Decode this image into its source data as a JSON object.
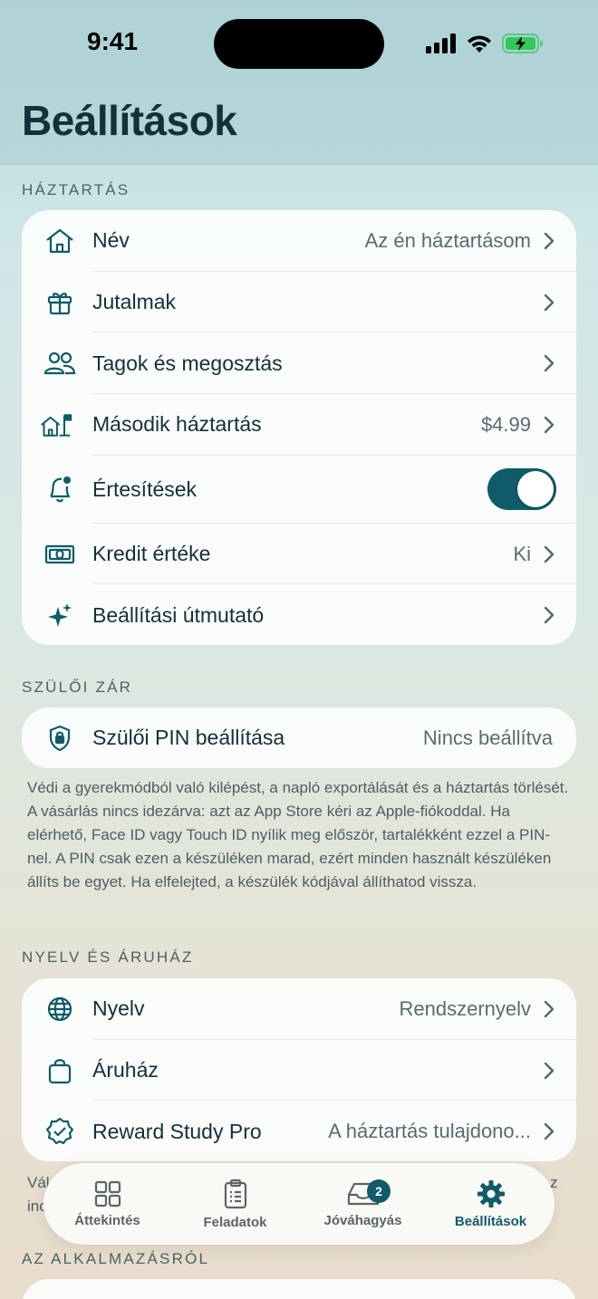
{
  "status": {
    "time": "9:41"
  },
  "header": {
    "title": "Beállítások"
  },
  "sections": {
    "household": {
      "label": "HÁZTARTÁS",
      "rows": [
        {
          "label": "Név",
          "value": "Az én háztartásom",
          "icon": "house-icon"
        },
        {
          "label": "Jutalmak",
          "value": "",
          "icon": "gift-icon"
        },
        {
          "label": "Tagok és megosztás",
          "value": "",
          "icon": "people-icon"
        },
        {
          "label": "Második háztartás",
          "value": "$4.99",
          "icon": "house-flag-icon"
        },
        {
          "label": "Értesítések",
          "toggle": true,
          "icon": "bell-icon"
        },
        {
          "label": "Kredit értéke",
          "value": "Ki",
          "icon": "banknote-icon"
        },
        {
          "label": "Beállítási útmutató",
          "value": "",
          "icon": "sparkles-icon"
        }
      ]
    },
    "parental_lock": {
      "label": "SZÜLŐI ZÁR",
      "row": {
        "label": "Szülői PIN beállítása",
        "value": "Nincs beállítva",
        "icon": "lock-shield-icon"
      },
      "note": "Védi a gyerekmódból való kilépést, a napló exportálását és a háztartás törlését. A vásárlás nincs idezárva: azt az App Store kéri az Apple-fiókoddal. Ha elérhető, Face ID vagy Touch ID nyílik meg először, tartalékként ezzel a PIN-nel. A PIN csak ezen a készüléken marad, ezért minden használt készüléken állíts be egyet. Ha elfelejted, a készülék kódjával állíthatod vissza."
    },
    "language_store": {
      "label": "NYELV ÉS ÁRUHÁZ",
      "rows": [
        {
          "label": "Nyelv",
          "value": "Rendszernyelv",
          "icon": "globe-icon"
        },
        {
          "label": "Áruház",
          "value": "",
          "icon": "bag-icon"
        },
        {
          "label": "Reward Study Pro",
          "value": "A háztartás tulajdono...",
          "icon": "checkmark-seal-icon"
        }
      ],
      "peek_left": "Vál",
      "peek_left2": "inc",
      "peek_right": "z"
    },
    "about": {
      "label": "AZ ALKALMAZÁSRÓL"
    }
  },
  "tabbar": {
    "tabs": [
      {
        "label": "Áttekintés",
        "icon": "grid-icon"
      },
      {
        "label": "Feladatok",
        "icon": "clipboard-icon"
      },
      {
        "label": "Jóváhagyás",
        "icon": "tray-icon",
        "badge": "2"
      },
      {
        "label": "Beállítások",
        "icon": "gear-icon",
        "active": true
      }
    ]
  },
  "colors": {
    "accent": "#0f5b69",
    "text": "#14303a",
    "secondary": "#5a6b70"
  }
}
